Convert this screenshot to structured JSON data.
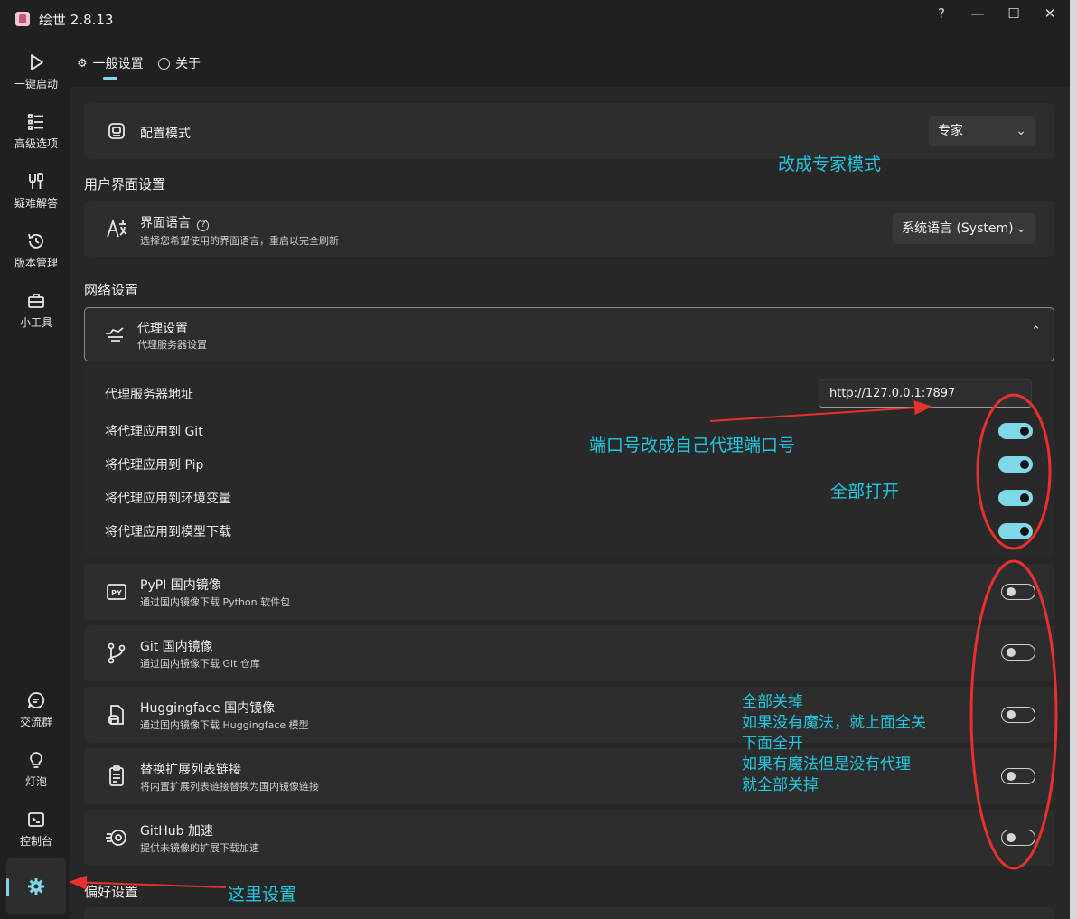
{
  "app": {
    "title": "绘世 2.8.13",
    "icon": "app-logo-icon"
  },
  "window_controls": {
    "help": "?",
    "minimize": "—",
    "maximize": "☐",
    "close": "✕"
  },
  "sidebar": {
    "items": [
      {
        "label": "一键启动",
        "icon": "play-icon"
      },
      {
        "label": "高级选项",
        "icon": "list-icon"
      },
      {
        "label": "疑难解答",
        "icon": "tools-icon"
      },
      {
        "label": "版本管理",
        "icon": "history-icon"
      },
      {
        "label": "小工具",
        "icon": "toolbox-icon"
      }
    ],
    "bottom_items": [
      {
        "label": "交流群",
        "icon": "chat-icon"
      },
      {
        "label": "灯泡",
        "icon": "lightbulb-icon"
      },
      {
        "label": "控制台",
        "icon": "console-icon"
      },
      {
        "label": "",
        "icon": "gear-icon",
        "active": true
      }
    ]
  },
  "tabs": [
    {
      "label": "一般设置",
      "icon": "gear-icon",
      "active": true
    },
    {
      "label": "关于",
      "icon": "info-icon"
    }
  ],
  "config_mode": {
    "title": "配置模式",
    "value": "专家",
    "icon": "config-icon"
  },
  "ui_section": {
    "title": "用户界面设置"
  },
  "language": {
    "title": "界面语言",
    "subtitle": "选择您希望使用的界面语言，重启以完全刷新",
    "value": "系统语言 (System)",
    "icon": "language-icon"
  },
  "network_section": {
    "title": "网络设置"
  },
  "proxy": {
    "title": "代理设置",
    "subtitle": "代理服务器设置",
    "icon": "proxy-icon",
    "expanded": true,
    "address_label": "代理服务器地址",
    "address_value": "http://127.0.0.1:7897",
    "toggles": [
      {
        "label": "将代理应用到 Git",
        "on": true
      },
      {
        "label": "将代理应用到 Pip",
        "on": true
      },
      {
        "label": "将代理应用到环境变量",
        "on": true
      },
      {
        "label": "将代理应用到模型下载",
        "on": true
      }
    ]
  },
  "mirrors": [
    {
      "title": "PyPI 国内镜像",
      "subtitle": "通过国内镜像下载 Python 软件包",
      "icon": "pypi-icon",
      "on": false
    },
    {
      "title": "Git 国内镜像",
      "subtitle": "通过国内镜像下载 Git 仓库",
      "icon": "git-branch-icon",
      "on": false
    },
    {
      "title": "Huggingface 国内镜像",
      "subtitle": "通过国内镜像下载 Huggingface 模型",
      "icon": "database-icon",
      "on": false
    },
    {
      "title": "替换扩展列表链接",
      "subtitle": "将内置扩展列表链接替换为国内镜像链接",
      "icon": "clipboard-icon",
      "on": false
    },
    {
      "title": "GitHub 加速",
      "subtitle": "提供未镜像的扩展下载加速",
      "icon": "speed-icon",
      "on": false
    }
  ],
  "preference_section": {
    "title": "偏好设置"
  },
  "annotations": {
    "expert_mode": "改成专家模式",
    "port": "端口号改成自己代理端口号",
    "all_on": "全部打开",
    "all_off": [
      "全部关掉",
      "如果没有魔法，就上面全关",
      "下面全开",
      "如果有魔法但是没有代理",
      "就全部关掉"
    ],
    "settings_here": "这里设置",
    "color": "#1ec8e0",
    "mark_color": "#e8302c"
  },
  "colors": {
    "accent": "#7fd8ea",
    "background": "#202020",
    "card": "#2d2d2d"
  }
}
